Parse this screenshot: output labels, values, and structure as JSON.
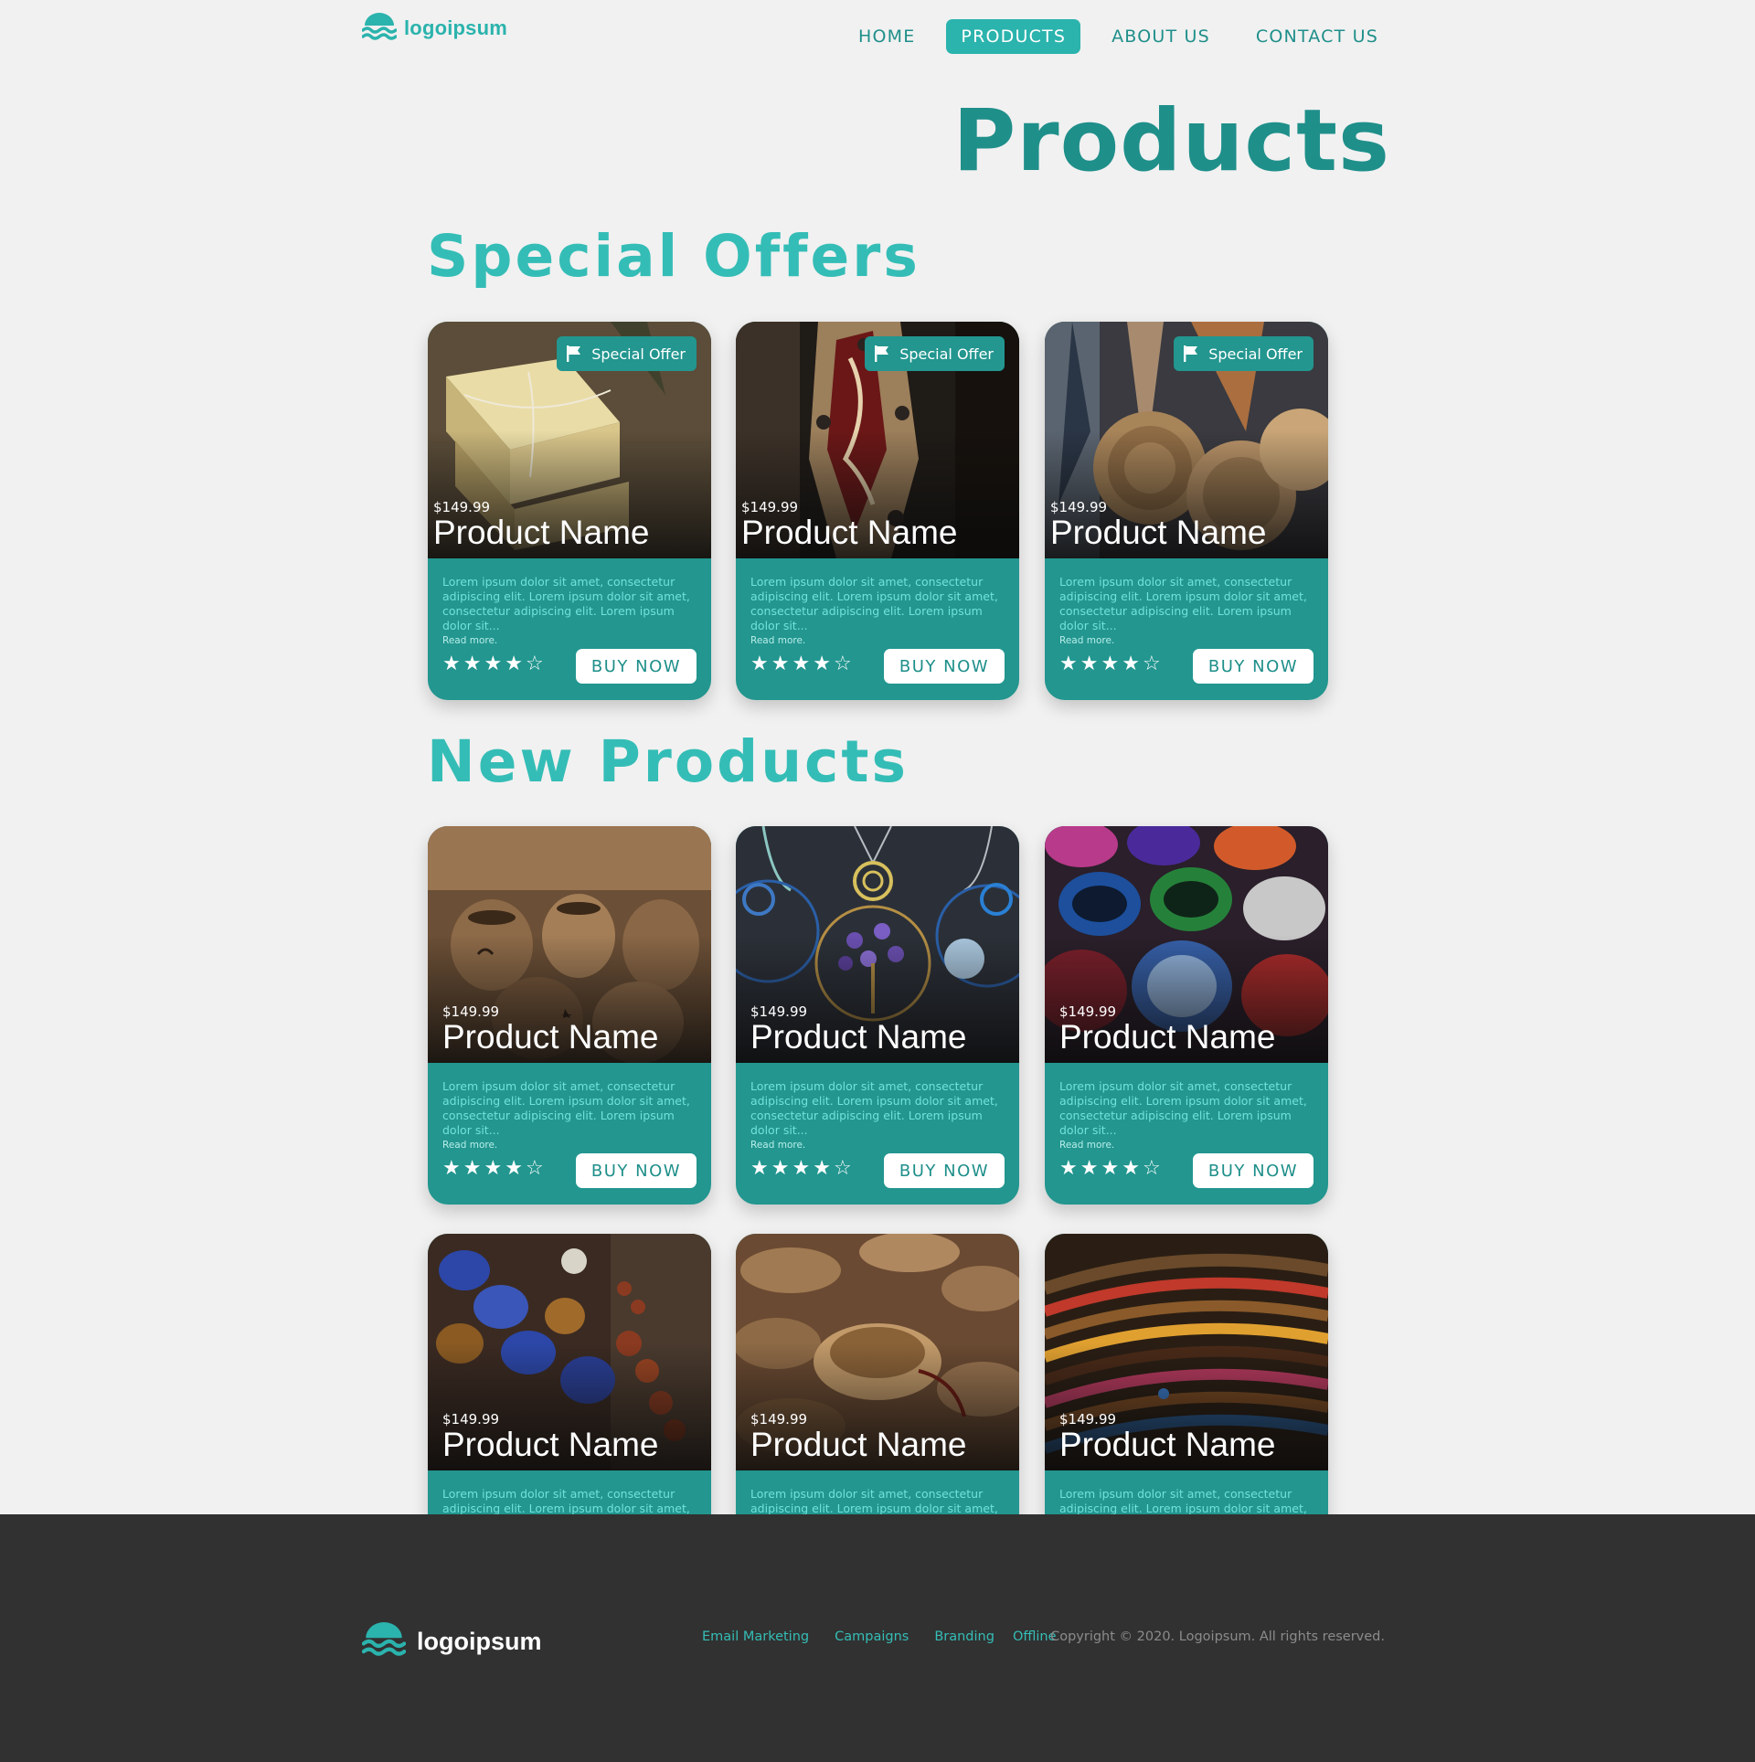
{
  "header": {
    "logo_text": "logoipsum",
    "nav": [
      {
        "label": "HOME",
        "active": false
      },
      {
        "label": "PRODUCTS",
        "active": true
      },
      {
        "label": "ABOUT US",
        "active": false
      },
      {
        "label": "CONTACT US",
        "active": false
      }
    ]
  },
  "page_title": "Products",
  "sections": {
    "special_offers": "Special Offers",
    "new_products": "New Products"
  },
  "special_offers": [
    {
      "badge": "Special Offer",
      "price": "$149.99",
      "name": "Product Name",
      "description": "Lorem ipsum dolor sit amet, consectetur adipiscing elit. Lorem ipsum dolor sit amet, consectetur adipiscing elit. Lorem ipsum dolor sit...",
      "read_more": "Read more.",
      "rating": 4,
      "buy_label": "BUY NOW",
      "image": "soap bars"
    },
    {
      "badge": "Special Offer",
      "price": "$149.99",
      "name": "Product Name",
      "description": "Lorem ipsum dolor sit amet, consectetur adipiscing elit. Lorem ipsum dolor sit amet, consectetur adipiscing elit. Lorem ipsum dolor sit...",
      "read_more": "Read more.",
      "rating": 4,
      "buy_label": "BUY NOW",
      "image": "painted wooden decor"
    },
    {
      "badge": "Special Offer",
      "price": "$149.99",
      "name": "Product Name",
      "description": "Lorem ipsum dolor sit amet, consectetur adipiscing elit. Lorem ipsum dolor sit amet, consectetur adipiscing elit. Lorem ipsum dolor sit...",
      "read_more": "Read more.",
      "rating": 4,
      "buy_label": "BUY NOW",
      "image": "woven rattan bags"
    }
  ],
  "new_products": [
    {
      "price": "$149.99",
      "name": "Product Name",
      "description": "Lorem ipsum dolor sit amet, consectetur adipiscing elit. Lorem ipsum dolor sit amet, consectetur adipiscing elit. Lorem ipsum dolor sit...",
      "read_more": "Read more.",
      "rating": 4,
      "buy_label": "BUY NOW",
      "image": "carved wooden pots"
    },
    {
      "price": "$149.99",
      "name": "Product Name",
      "description": "Lorem ipsum dolor sit amet, consectetur adipiscing elit. Lorem ipsum dolor sit amet, consectetur adipiscing elit. Lorem ipsum dolor sit...",
      "read_more": "Read more.",
      "rating": 4,
      "buy_label": "BUY NOW",
      "image": "wire pendants"
    },
    {
      "price": "$149.99",
      "name": "Product Name",
      "description": "Lorem ipsum dolor sit amet, consectetur adipiscing elit. Lorem ipsum dolor sit amet, consectetur adipiscing elit. Lorem ipsum dolor sit...",
      "read_more": "Read more.",
      "rating": 4,
      "buy_label": "BUY NOW",
      "image": "painted bowls"
    },
    {
      "price": "$149.99",
      "name": "Product Name",
      "description": "Lorem ipsum dolor sit amet, consectetur adipiscing elit. Lorem ipsum dolor sit amet, consectetur",
      "image": "beaded necklaces"
    },
    {
      "price": "$149.99",
      "name": "Product Name",
      "description": "Lorem ipsum dolor sit amet, consectetur adipiscing elit. Lorem ipsum dolor sit amet, consectetur",
      "image": "wooden coasters and bowls"
    },
    {
      "price": "$149.99",
      "name": "Product Name",
      "description": "Lorem ipsum dolor sit amet, consectetur adipiscing elit. Lorem ipsum dolor sit amet, consectetur",
      "image": "colorful bangles"
    }
  ],
  "footer": {
    "logo_text": "logoipsum",
    "links": [
      "Email Marketing",
      "Campaigns",
      "Branding",
      "Offline"
    ],
    "copyright": "Copyright © 2020. Logoipsum. All rights reserved."
  },
  "colors": {
    "accent": "#2bb3ad",
    "accent_dark": "#1f8f8a",
    "card": "#22968f",
    "footer_bg": "#313131",
    "page_bg": "#f1f1f1"
  }
}
